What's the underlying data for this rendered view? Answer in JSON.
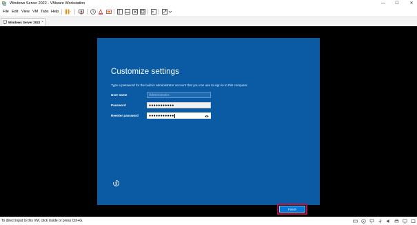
{
  "window": {
    "title": "Windows Server 2022 - VMware Workstation",
    "minimize": "—",
    "maximize": "☐",
    "close": "✕"
  },
  "menu": {
    "items": [
      "File",
      "Edit",
      "View",
      "VM",
      "Tabs",
      "Help"
    ]
  },
  "tabs": [
    {
      "label": "Windows Server 2022",
      "close": "×"
    }
  ],
  "setup": {
    "title": "Customize settings",
    "description": "Type a password for the built-in administrator account that you can use to sign in to this computer.",
    "username_label": "User name",
    "username_value": "Administrator",
    "password_label": "Password",
    "password_value": "●●●●●●●●●●●",
    "reenter_label": "Reenter password",
    "reenter_value": "●●●●●●●●●●●",
    "finish_label": "Finish"
  },
  "statusbar": {
    "text": "To direct input to this VM, click inside or press Ctrl+G."
  },
  "colors": {
    "oobe_background": "#0a5ba4",
    "finish_button": "#0078d7",
    "highlight_border": "#b0134f"
  },
  "icons": {
    "app": "vmware-icon",
    "pause": "pause-icon",
    "snapshot": "snapshot-icon",
    "fullscreen": "fullscreen-icon",
    "console": "console-icon",
    "password_reveal": "eye-icon",
    "accessibility": "ease-of-access-icon"
  }
}
